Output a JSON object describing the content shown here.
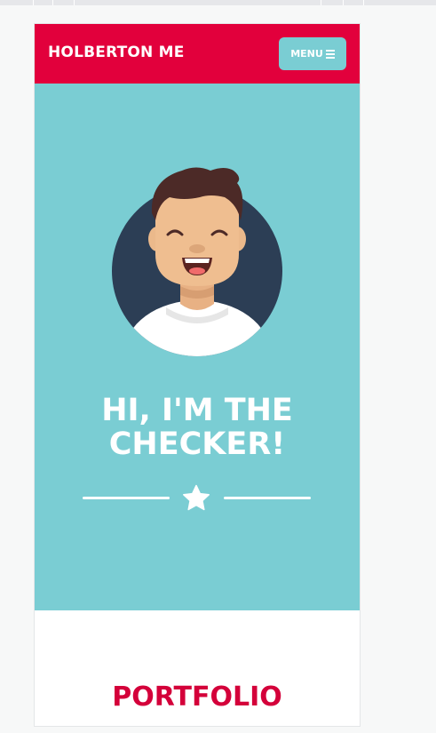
{
  "navbar": {
    "brand": "HOLBERTON ME",
    "menu_label": "MENU",
    "menu_icon": "bars-icon"
  },
  "hero": {
    "title_line1": "HI, I'M THE",
    "title_line2": "CHECKER!",
    "divider_icon": "star-icon"
  },
  "portfolio": {
    "title": "PORTFOLIO"
  },
  "colors": {
    "primary": "#e2003c",
    "accent": "#7acdd3",
    "portfolio_title": "#d4003a",
    "page_bg": "#f7f8f8"
  }
}
